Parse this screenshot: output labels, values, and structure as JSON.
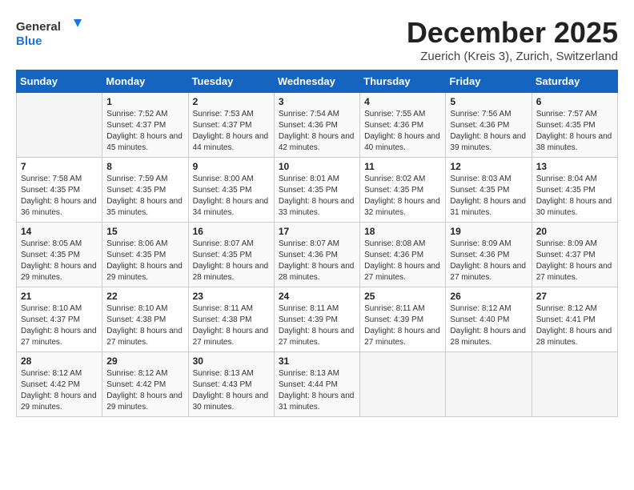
{
  "header": {
    "logo_general": "General",
    "logo_blue": "Blue",
    "month_title": "December 2025",
    "location": "Zuerich (Kreis 3), Zurich, Switzerland"
  },
  "weekdays": [
    "Sunday",
    "Monday",
    "Tuesday",
    "Wednesday",
    "Thursday",
    "Friday",
    "Saturday"
  ],
  "weeks": [
    [
      {
        "day": "",
        "sunrise": "",
        "sunset": "",
        "daylight": ""
      },
      {
        "day": "1",
        "sunrise": "Sunrise: 7:52 AM",
        "sunset": "Sunset: 4:37 PM",
        "daylight": "Daylight: 8 hours and 45 minutes."
      },
      {
        "day": "2",
        "sunrise": "Sunrise: 7:53 AM",
        "sunset": "Sunset: 4:37 PM",
        "daylight": "Daylight: 8 hours and 44 minutes."
      },
      {
        "day": "3",
        "sunrise": "Sunrise: 7:54 AM",
        "sunset": "Sunset: 4:36 PM",
        "daylight": "Daylight: 8 hours and 42 minutes."
      },
      {
        "day": "4",
        "sunrise": "Sunrise: 7:55 AM",
        "sunset": "Sunset: 4:36 PM",
        "daylight": "Daylight: 8 hours and 40 minutes."
      },
      {
        "day": "5",
        "sunrise": "Sunrise: 7:56 AM",
        "sunset": "Sunset: 4:36 PM",
        "daylight": "Daylight: 8 hours and 39 minutes."
      },
      {
        "day": "6",
        "sunrise": "Sunrise: 7:57 AM",
        "sunset": "Sunset: 4:35 PM",
        "daylight": "Daylight: 8 hours and 38 minutes."
      }
    ],
    [
      {
        "day": "7",
        "sunrise": "Sunrise: 7:58 AM",
        "sunset": "Sunset: 4:35 PM",
        "daylight": "Daylight: 8 hours and 36 minutes."
      },
      {
        "day": "8",
        "sunrise": "Sunrise: 7:59 AM",
        "sunset": "Sunset: 4:35 PM",
        "daylight": "Daylight: 8 hours and 35 minutes."
      },
      {
        "day": "9",
        "sunrise": "Sunrise: 8:00 AM",
        "sunset": "Sunset: 4:35 PM",
        "daylight": "Daylight: 8 hours and 34 minutes."
      },
      {
        "day": "10",
        "sunrise": "Sunrise: 8:01 AM",
        "sunset": "Sunset: 4:35 PM",
        "daylight": "Daylight: 8 hours and 33 minutes."
      },
      {
        "day": "11",
        "sunrise": "Sunrise: 8:02 AM",
        "sunset": "Sunset: 4:35 PM",
        "daylight": "Daylight: 8 hours and 32 minutes."
      },
      {
        "day": "12",
        "sunrise": "Sunrise: 8:03 AM",
        "sunset": "Sunset: 4:35 PM",
        "daylight": "Daylight: 8 hours and 31 minutes."
      },
      {
        "day": "13",
        "sunrise": "Sunrise: 8:04 AM",
        "sunset": "Sunset: 4:35 PM",
        "daylight": "Daylight: 8 hours and 30 minutes."
      }
    ],
    [
      {
        "day": "14",
        "sunrise": "Sunrise: 8:05 AM",
        "sunset": "Sunset: 4:35 PM",
        "daylight": "Daylight: 8 hours and 29 minutes."
      },
      {
        "day": "15",
        "sunrise": "Sunrise: 8:06 AM",
        "sunset": "Sunset: 4:35 PM",
        "daylight": "Daylight: 8 hours and 29 minutes."
      },
      {
        "day": "16",
        "sunrise": "Sunrise: 8:07 AM",
        "sunset": "Sunset: 4:35 PM",
        "daylight": "Daylight: 8 hours and 28 minutes."
      },
      {
        "day": "17",
        "sunrise": "Sunrise: 8:07 AM",
        "sunset": "Sunset: 4:36 PM",
        "daylight": "Daylight: 8 hours and 28 minutes."
      },
      {
        "day": "18",
        "sunrise": "Sunrise: 8:08 AM",
        "sunset": "Sunset: 4:36 PM",
        "daylight": "Daylight: 8 hours and 27 minutes."
      },
      {
        "day": "19",
        "sunrise": "Sunrise: 8:09 AM",
        "sunset": "Sunset: 4:36 PM",
        "daylight": "Daylight: 8 hours and 27 minutes."
      },
      {
        "day": "20",
        "sunrise": "Sunrise: 8:09 AM",
        "sunset": "Sunset: 4:37 PM",
        "daylight": "Daylight: 8 hours and 27 minutes."
      }
    ],
    [
      {
        "day": "21",
        "sunrise": "Sunrise: 8:10 AM",
        "sunset": "Sunset: 4:37 PM",
        "daylight": "Daylight: 8 hours and 27 minutes."
      },
      {
        "day": "22",
        "sunrise": "Sunrise: 8:10 AM",
        "sunset": "Sunset: 4:38 PM",
        "daylight": "Daylight: 8 hours and 27 minutes."
      },
      {
        "day": "23",
        "sunrise": "Sunrise: 8:11 AM",
        "sunset": "Sunset: 4:38 PM",
        "daylight": "Daylight: 8 hours and 27 minutes."
      },
      {
        "day": "24",
        "sunrise": "Sunrise: 8:11 AM",
        "sunset": "Sunset: 4:39 PM",
        "daylight": "Daylight: 8 hours and 27 minutes."
      },
      {
        "day": "25",
        "sunrise": "Sunrise: 8:11 AM",
        "sunset": "Sunset: 4:39 PM",
        "daylight": "Daylight: 8 hours and 27 minutes."
      },
      {
        "day": "26",
        "sunrise": "Sunrise: 8:12 AM",
        "sunset": "Sunset: 4:40 PM",
        "daylight": "Daylight: 8 hours and 28 minutes."
      },
      {
        "day": "27",
        "sunrise": "Sunrise: 8:12 AM",
        "sunset": "Sunset: 4:41 PM",
        "daylight": "Daylight: 8 hours and 28 minutes."
      }
    ],
    [
      {
        "day": "28",
        "sunrise": "Sunrise: 8:12 AM",
        "sunset": "Sunset: 4:42 PM",
        "daylight": "Daylight: 8 hours and 29 minutes."
      },
      {
        "day": "29",
        "sunrise": "Sunrise: 8:12 AM",
        "sunset": "Sunset: 4:42 PM",
        "daylight": "Daylight: 8 hours and 29 minutes."
      },
      {
        "day": "30",
        "sunrise": "Sunrise: 8:13 AM",
        "sunset": "Sunset: 4:43 PM",
        "daylight": "Daylight: 8 hours and 30 minutes."
      },
      {
        "day": "31",
        "sunrise": "Sunrise: 8:13 AM",
        "sunset": "Sunset: 4:44 PM",
        "daylight": "Daylight: 8 hours and 31 minutes."
      },
      {
        "day": "",
        "sunrise": "",
        "sunset": "",
        "daylight": ""
      },
      {
        "day": "",
        "sunrise": "",
        "sunset": "",
        "daylight": ""
      },
      {
        "day": "",
        "sunrise": "",
        "sunset": "",
        "daylight": ""
      }
    ]
  ]
}
